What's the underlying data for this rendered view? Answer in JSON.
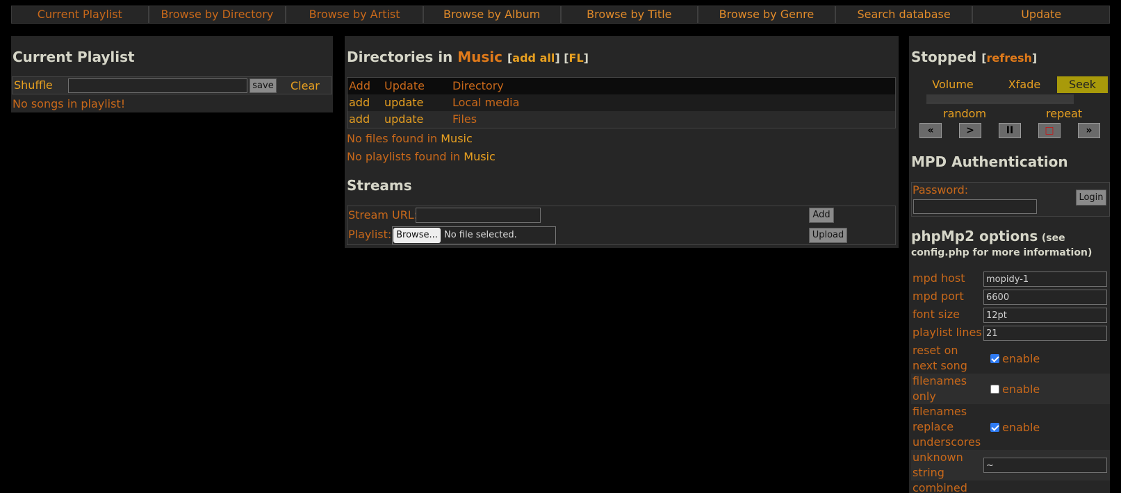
{
  "nav": [
    {
      "label": "Current Playlist",
      "tone": "dark"
    },
    {
      "label": "Browse by Directory",
      "tone": "dark"
    },
    {
      "label": "Browse by Artist",
      "tone": "dark"
    },
    {
      "label": "Browse by Album",
      "tone": "light"
    },
    {
      "label": "Browse by Title",
      "tone": "light"
    },
    {
      "label": "Browse by Genre",
      "tone": "light"
    },
    {
      "label": "Search database",
      "tone": "light"
    },
    {
      "label": "Update",
      "tone": "light"
    }
  ],
  "playlist": {
    "title": "Current Playlist",
    "shuffle_label": "Shuffle",
    "name_input_value": "",
    "save_label": "save",
    "clear_label": "Clear",
    "empty_message": "No songs in playlist!"
  },
  "directories": {
    "title_prefix": "Directories in ",
    "folder": "Music",
    "add_all_label": "add all",
    "fl_label": "FL",
    "columns": [
      "Add",
      "Update",
      "Directory"
    ],
    "rows": [
      {
        "add": "add",
        "update": "update",
        "name": "Local media"
      },
      {
        "add": "add",
        "update": "update",
        "name": "Files"
      }
    ],
    "no_files_prefix": "No files found in ",
    "no_playlists_prefix": "No playlists found in ",
    "folder_ref": "Music"
  },
  "streams": {
    "title": "Streams",
    "url_label": "Stream URL:",
    "url_value": "",
    "add_label": "Add",
    "playlist_label": "Playlist:",
    "browse_label": "Browse...",
    "file_status": "No file selected.",
    "upload_label": "Upload"
  },
  "status": {
    "state": "Stopped",
    "refresh_label": "refresh",
    "tabs": [
      "Volume",
      "Xfade",
      "Seek"
    ],
    "active_tab": "Seek",
    "random_label": "random",
    "repeat_label": "repeat",
    "controls": [
      {
        "name": "previous-icon",
        "glyph": "«"
      },
      {
        "name": "play-icon",
        "glyph": ">"
      },
      {
        "name": "pause-icon",
        "glyph": "II"
      },
      {
        "name": "stop-icon",
        "glyph": "□"
      },
      {
        "name": "next-icon",
        "glyph": "»"
      }
    ]
  },
  "auth": {
    "title": "MPD Authentication",
    "password_label": "Password:",
    "login_label": "Login"
  },
  "options": {
    "title": "phpMp2 options",
    "note": "(see config.php for more information)",
    "enable_label": "enable",
    "mpd_host": {
      "label": "mpd host",
      "value": "mopidy-1"
    },
    "mpd_port": {
      "label": "mpd port",
      "value": "6600"
    },
    "font_size": {
      "label": "font size",
      "value": "12pt"
    },
    "playlist_lines": {
      "label": "playlist lines",
      "value": "21"
    },
    "reset_next": {
      "label": "reset on next song",
      "checked": true
    },
    "filenames_only": {
      "label": "filenames only",
      "checked": false
    },
    "replace_underscores": {
      "label": "filenames replace underscores",
      "checked": true
    },
    "unknown_string": {
      "label": "unknown string",
      "value": "~"
    },
    "combined": {
      "label": "combined"
    }
  },
  "colors": {
    "accent": "#c8681a",
    "highlight": "#e8a020",
    "seek_active": "#a89a0a",
    "heading": "#d6d6c8",
    "panel": "#262626",
    "background": "#000000"
  }
}
